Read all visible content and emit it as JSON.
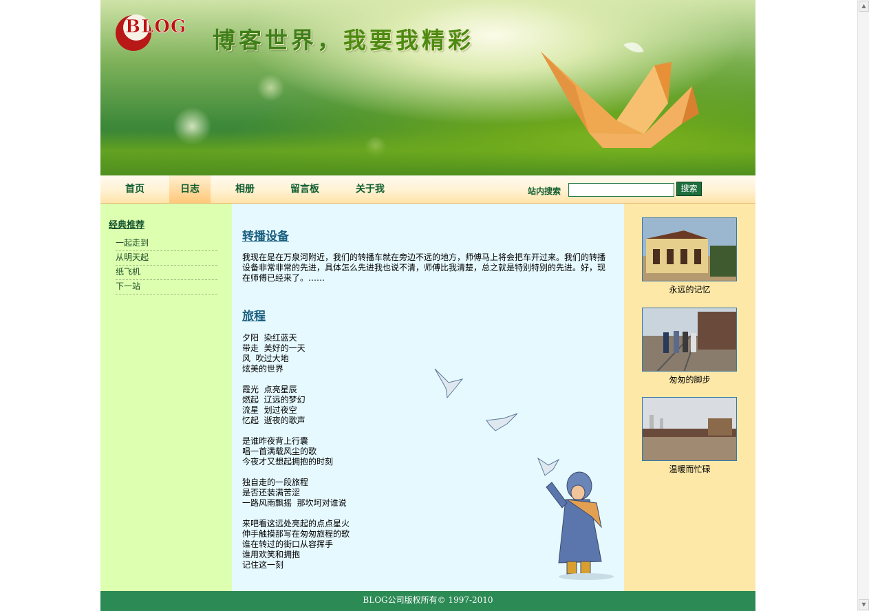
{
  "banner": {
    "logo_text": "BLOG",
    "slogan_part1": "博客世界，",
    "slogan_part2": "我要我精彩"
  },
  "nav": {
    "items": [
      {
        "label": "首页",
        "active": false
      },
      {
        "label": "日志",
        "active": true
      },
      {
        "label": "相册",
        "active": false
      },
      {
        "label": "留言板",
        "active": false
      },
      {
        "label": "关于我",
        "active": false
      }
    ],
    "search_label": "站内搜索",
    "search_value": "",
    "search_button": "搜索"
  },
  "sidebar": {
    "heading": "经典推荐",
    "items": [
      "一起走到",
      "从明天起",
      "纸飞机",
      "下一站"
    ]
  },
  "main": {
    "posts": [
      {
        "title": "转播设备",
        "body": "我现在是在万泉河附近，我们的转播车就在旁边不远的地方，师傅马上将会把车开过来。我们的转播设备非常非常的先进，具体怎么先进我也说不清，师傅比我清楚，总之就是特别特别的先进。好，现在师傅已经来了。……"
      },
      {
        "title": "旅程",
        "stanzas": [
          [
            "夕阳  染红蓝天",
            "带走  美好的一天",
            "风  吹过大地",
            "炫美的世界"
          ],
          [
            "霞光  点亮星辰",
            "燃起  辽远的梦幻",
            "流星  划过夜空",
            "忆起  逝夜的歌声"
          ],
          [
            "是谁昨夜背上行囊",
            "唱一首满载风尘的歌",
            "今夜才又想起拥抱的时刻"
          ],
          [
            "独自走的一段旅程",
            "是否还装满苦涩",
            "一路风雨飘摇  那坎坷对谁说"
          ],
          [
            "来吧看这远处亮起的点点星火",
            "伸手触摸那写在匆匆旅程的歌",
            "谁在转过的街口从容挥手",
            "谁用欢笑和拥抱",
            "记住这一刻"
          ]
        ]
      }
    ]
  },
  "right_sidebar": {
    "photos": [
      {
        "caption": "永远的记忆",
        "scene": "building-photo"
      },
      {
        "caption": "匆匆的脚步",
        "scene": "railway-walkers-photo"
      },
      {
        "caption": "温暖而忙碌",
        "scene": "station-platform-photo"
      }
    ]
  },
  "footer": {
    "text": "BLOG公司版权所有© 1997-2010"
  },
  "colors": {
    "nav_text": "#0f5c2e",
    "left_bg": "#ddffb0",
    "main_bg": "#e6f9ff",
    "right_bg": "#fde8a8",
    "footer_bg": "#2c8a55",
    "post_title": "#1a5f7f"
  }
}
